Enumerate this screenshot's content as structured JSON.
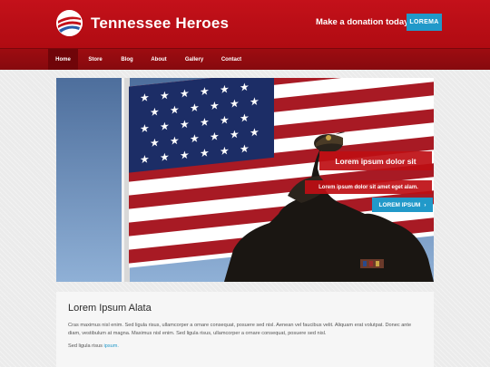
{
  "header": {
    "title": "Tennessee Heroes",
    "donate_text": "Make a donation today!",
    "donate_button": "LOREMA"
  },
  "nav": [
    "Home",
    "Store",
    "Blog",
    "About",
    "Gallery",
    "Contact"
  ],
  "hero": {
    "caption_title": "Lorem ipsum dolor sit",
    "caption_sub": "Lorem ipsum dolor sit amet eget alam.",
    "button_label": "LOREM IPSUM",
    "button_icon": "›"
  },
  "content": {
    "heading": "Lorem Ipsum Alata",
    "paragraph1": "Cras maximus nisl enim. Sed ligula risus, ullamcorper a ornare consequat, posuere sed nisl. Aenean vel faucibus velit. Aliquam erat volutpat. Donec ante diam, vestibulum at magna. Maximus nisl enim. Sed ligula risus, ullamcorper a ornare consequat, posuere sed nisl.",
    "paragraph2_text": "Sed ligula risus ",
    "paragraph2_link": "ipsum."
  }
}
